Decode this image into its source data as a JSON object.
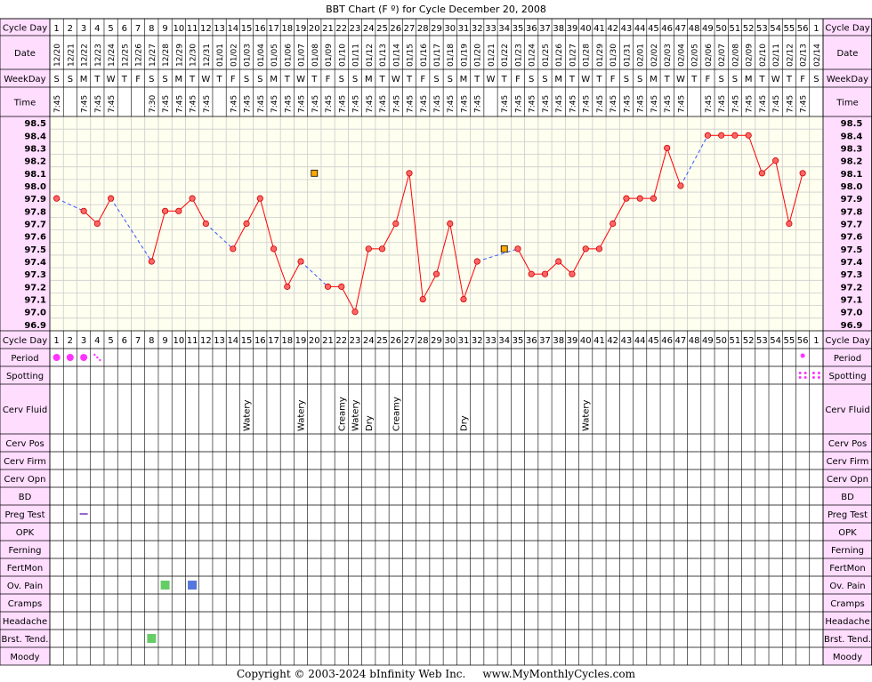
{
  "title": "BBT Chart (F º) for Cycle December 20, 2008",
  "copyright": "Copyright © 2003-2024 bInfinity Web Inc.     www.MyMonthlyCycles.com",
  "row_labels": {
    "cycle_day": "Cycle Day",
    "date": "Date",
    "weekday": "WeekDay",
    "time": "Time",
    "attributes": [
      "Period",
      "Spotting",
      "Cerv Fluid",
      "Cerv Pos",
      "Cerv Firm",
      "Cerv Opn",
      "BD",
      "Preg Test",
      "OPK",
      "Ferning",
      "FertMon",
      "Ov. Pain",
      "Cramps",
      "Headache",
      "Brst. Tend.",
      "Moody"
    ]
  },
  "colors": {
    "temp_line": "#ff0000",
    "temp_marker_fill": "#ff6666",
    "gap_line": "#3355ff",
    "outlier_fill": "#ffaa00",
    "period": "#ff33ff",
    "label_bg": "#ffddff",
    "plot_bg": "#fffff0",
    "grid": "#cccccc",
    "ov_pain_green": "#66cc66",
    "ov_pain_blue": "#5577dd",
    "brst_green": "#66cc66",
    "preg_test": "#9966cc"
  },
  "chart_data": {
    "type": "line",
    "title": "BBT Chart (F º) for Cycle December 20, 2008",
    "ylabel": "",
    "xlabel": "Cycle Day",
    "ylim": [
      96.9,
      98.5
    ],
    "y_ticks": [
      "98.5",
      "98.4",
      "98.3",
      "98.2",
      "98.1",
      "98.0",
      "97.9",
      "97.8",
      "97.7",
      "97.6",
      "97.5",
      "97.4",
      "97.3",
      "97.2",
      "97.1",
      "97.0",
      "96.9"
    ],
    "cycle_days": [
      "1",
      "2",
      "3",
      "4",
      "5",
      "6",
      "7",
      "8",
      "9",
      "10",
      "11",
      "12",
      "13",
      "14",
      "15",
      "16",
      "17",
      "18",
      "19",
      "20",
      "21",
      "22",
      "23",
      "24",
      "25",
      "26",
      "27",
      "28",
      "29",
      "30",
      "31",
      "32",
      "33",
      "34",
      "35",
      "36",
      "37",
      "38",
      "39",
      "40",
      "41",
      "42",
      "43",
      "44",
      "45",
      "46",
      "47",
      "48",
      "49",
      "50",
      "51",
      "52",
      "53",
      "54",
      "55",
      "56",
      "1"
    ],
    "dates": [
      "12/20",
      "12/21",
      "12/22",
      "12/23",
      "12/24",
      "12/25",
      "12/26",
      "12/27",
      "12/28",
      "12/29",
      "12/30",
      "12/31",
      "01/01",
      "01/02",
      "01/03",
      "01/04",
      "01/05",
      "01/06",
      "01/07",
      "01/08",
      "01/09",
      "01/10",
      "01/11",
      "01/12",
      "01/13",
      "01/14",
      "01/15",
      "01/16",
      "01/17",
      "01/18",
      "01/19",
      "01/20",
      "01/21",
      "01/22",
      "01/23",
      "01/24",
      "01/25",
      "01/26",
      "01/27",
      "01/28",
      "01/29",
      "01/30",
      "01/31",
      "02/01",
      "02/02",
      "02/03",
      "02/04",
      "02/05",
      "02/06",
      "02/07",
      "02/08",
      "02/09",
      "02/10",
      "02/11",
      "02/12",
      "02/13",
      "02/14"
    ],
    "weekdays": [
      "S",
      "S",
      "M",
      "T",
      "W",
      "T",
      "F",
      "S",
      "S",
      "M",
      "T",
      "W",
      "T",
      "F",
      "S",
      "S",
      "M",
      "T",
      "W",
      "T",
      "F",
      "S",
      "S",
      "M",
      "T",
      "W",
      "T",
      "F",
      "S",
      "S",
      "M",
      "T",
      "W",
      "T",
      "F",
      "S",
      "S",
      "M",
      "T",
      "W",
      "T",
      "F",
      "S",
      "S",
      "M",
      "T",
      "W",
      "T",
      "F",
      "S",
      "S",
      "M",
      "T",
      "W",
      "T",
      "F",
      "S"
    ],
    "times": [
      "7:45",
      "",
      "7:45",
      "7:45",
      "7:45",
      "",
      "",
      "7:30",
      "7:45",
      "7:45",
      "7:45",
      "7:45",
      "",
      "7:45",
      "7:45",
      "7:45",
      "7:45",
      "7:45",
      "7:45",
      "7:45",
      "7:45",
      "7:45",
      "7:45",
      "7:45",
      "7:45",
      "7:45",
      "7:45",
      "7:45",
      "7:45",
      "7:45",
      "7:45",
      "7:45",
      "",
      "7:45",
      "7:45",
      "7:45",
      "7:45",
      "7:45",
      "7:45",
      "7:45",
      "7:45",
      "7:45",
      "7:45",
      "7:45",
      "7:45",
      "7:45",
      "7:45",
      "",
      "7:45",
      "7:45",
      "7:45",
      "7:45",
      "7:45",
      "7:45",
      "7:45",
      "7:45",
      ""
    ],
    "series": [
      {
        "values": [
          97.9,
          null,
          97.8,
          97.7,
          97.9,
          null,
          null,
          97.4,
          97.8,
          97.8,
          97.9,
          97.7,
          null,
          97.5,
          97.7,
          97.9,
          97.5,
          97.2,
          97.4,
          null,
          97.2,
          97.2,
          97.0,
          97.5,
          97.5,
          97.7,
          98.1,
          97.1,
          97.3,
          97.7,
          97.1,
          97.4,
          null,
          null,
          97.5,
          97.3,
          97.3,
          97.4,
          97.3,
          97.5,
          97.5,
          97.7,
          97.9,
          97.9,
          97.9,
          98.3,
          98.0,
          null,
          98.4,
          98.4,
          98.4,
          98.4,
          98.1,
          98.2,
          97.7,
          98.1,
          null
        ]
      }
    ],
    "excluded_points": [
      {
        "day_index": 19,
        "value": 98.1
      },
      {
        "day_index": 33,
        "value": 97.5
      }
    ],
    "observations": {
      "period": [
        {
          "day_index": 0,
          "type": "dot"
        },
        {
          "day_index": 1,
          "type": "dot"
        },
        {
          "day_index": 2,
          "type": "dot"
        },
        {
          "day_index": 3,
          "type": "light"
        },
        {
          "day_index": 55,
          "type": "small"
        }
      ],
      "spotting": [
        {
          "day_index": 55
        },
        {
          "day_index": 56
        }
      ],
      "cerv_fluid": [
        {
          "day_index": 14,
          "text": "Watery"
        },
        {
          "day_index": 18,
          "text": "Watery"
        },
        {
          "day_index": 21,
          "text": "Creamy"
        },
        {
          "day_index": 22,
          "text": "Watery"
        },
        {
          "day_index": 23,
          "text": "Dry"
        },
        {
          "day_index": 25,
          "text": "Creamy"
        },
        {
          "day_index": 30,
          "text": "Dry"
        },
        {
          "day_index": 39,
          "text": "Watery"
        }
      ],
      "preg_test": [
        {
          "day_index": 2
        }
      ],
      "ov_pain": [
        {
          "day_index": 8,
          "color": "green"
        },
        {
          "day_index": 10,
          "color": "blue"
        }
      ],
      "brst_tend": [
        {
          "day_index": 7,
          "color": "green"
        }
      ]
    }
  }
}
